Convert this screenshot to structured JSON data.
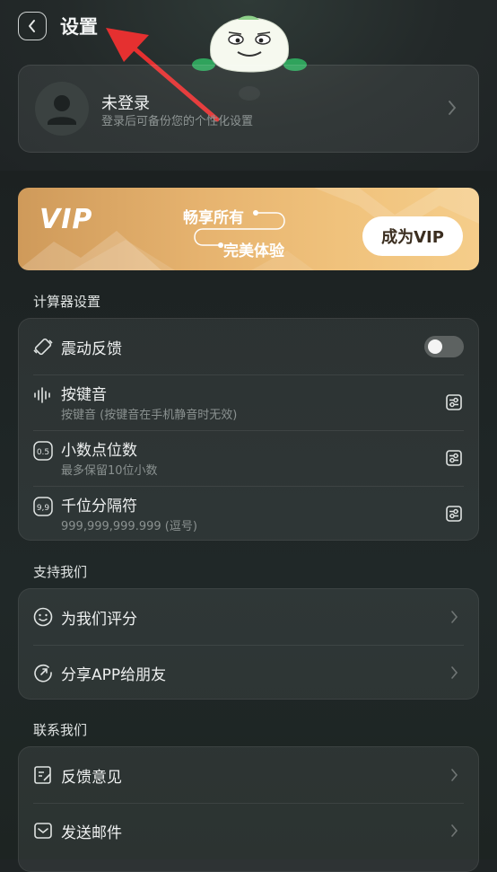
{
  "header": {
    "title": "设置"
  },
  "login": {
    "title": "未登录",
    "subtitle": "登录后可备份您的个性化设置"
  },
  "vip": {
    "logo": "VIP",
    "line1": "畅享所有",
    "line2": "完美体验",
    "button": "成为VIP"
  },
  "sections": {
    "calculator": {
      "title": "计算器设置",
      "vibration": {
        "label": "震动反馈",
        "enabled": false
      },
      "keysound": {
        "label": "按键音",
        "sub": "按键音 (按键音在手机静音时无效)"
      },
      "decimals": {
        "label": "小数点位数",
        "sub": "最多保留10位小数",
        "icon_text": "0.5"
      },
      "separator": {
        "label": "千位分隔符",
        "sub": "999,999,999.999 (逗号)",
        "icon_text": "9,9"
      }
    },
    "support": {
      "title": "支持我们",
      "rate": {
        "label": "为我们评分"
      },
      "share": {
        "label": "分享APP给朋友"
      }
    },
    "contact": {
      "title": "联系我们",
      "feedback": {
        "label": "反馈意见"
      },
      "email": {
        "label": "发送邮件"
      }
    }
  },
  "colors": {
    "vip_gold": "#e6b36f",
    "arrow_red": "#e53030",
    "mascot_green": "#2fa35c"
  }
}
